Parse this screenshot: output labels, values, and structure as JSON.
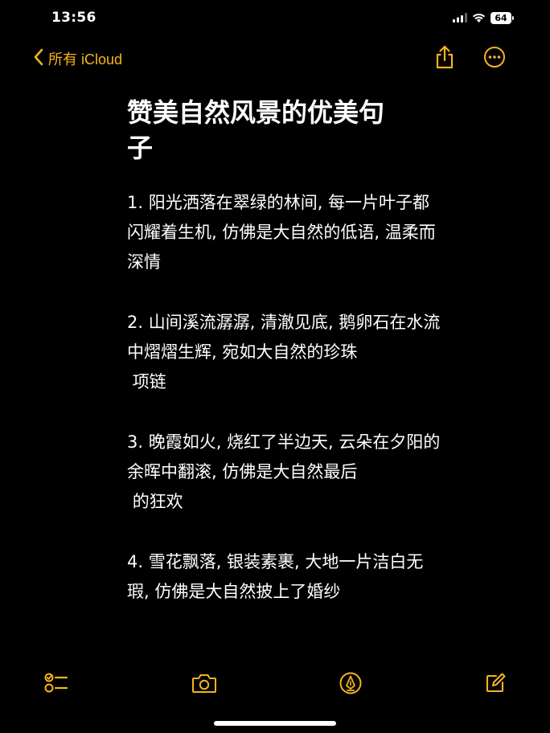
{
  "status_bar": {
    "time": "13:56",
    "battery": "64"
  },
  "nav": {
    "back_label": "所有 iCloud",
    "share_icon": "share-icon",
    "more_icon": "ellipsis-circle-icon"
  },
  "note": {
    "title": "赞美自然风景的优美句子",
    "paragraphs": [
      "1. 阳光洒落在翠绿的林间, 每一片叶子都闪耀着生机, 仿佛是大自然的低语, 温柔而深情",
      "2. 山间溪流潺潺, 清澈见底, 鹅卵石在水流中熠熠生辉, 宛如大自然的珍珠\n 项链",
      "3. 晚霞如火, 烧红了半边天, 云朵在夕阳的余晖中翻滚, 仿佛是大自然最后\n 的狂欢",
      "4. 雪花飘落, 银装素裹, 大地一片洁白无瑕, 仿佛是大自然披上了婚纱"
    ]
  },
  "toolbar": {
    "checklist_icon": "checklist-icon",
    "camera_icon": "camera-icon",
    "markup_icon": "pen-circle-icon",
    "compose_icon": "compose-icon"
  },
  "colors": {
    "accent": "#f5b41d",
    "background": "#000000",
    "text": "#ffffff"
  }
}
